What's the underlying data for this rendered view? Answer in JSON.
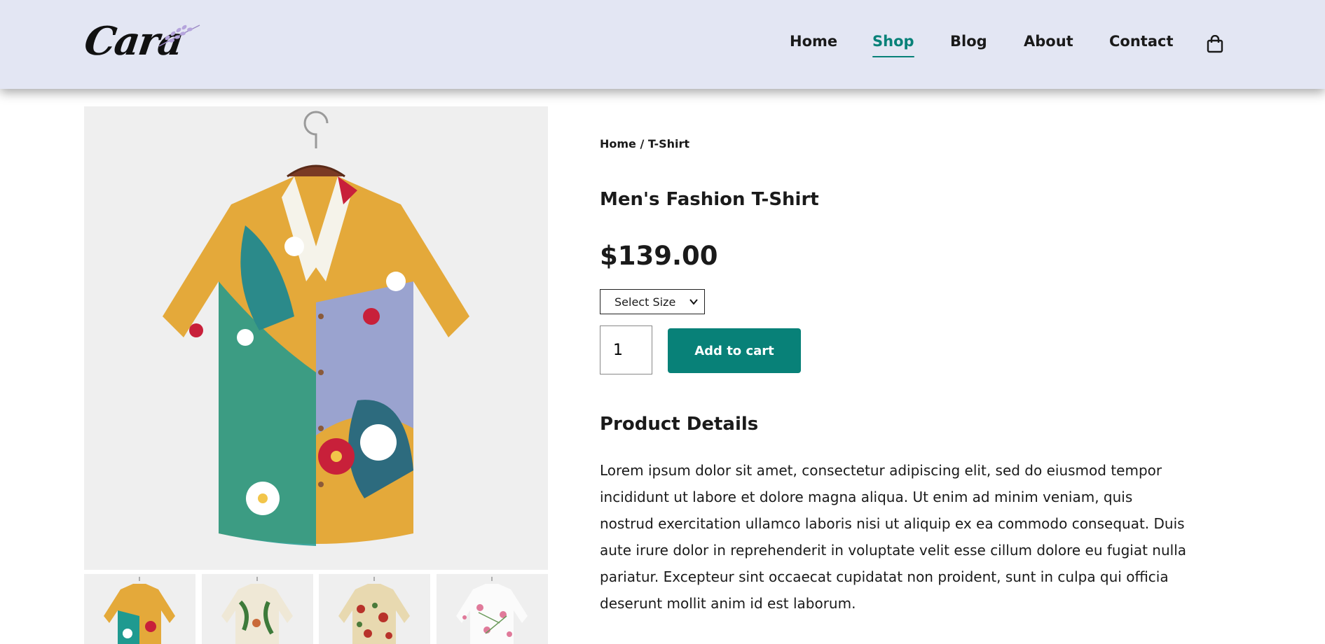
{
  "header": {
    "logo_text": "Cara",
    "nav": [
      {
        "label": "Home",
        "active": false
      },
      {
        "label": "Shop",
        "active": true
      },
      {
        "label": "Blog",
        "active": false
      },
      {
        "label": "About",
        "active": false
      },
      {
        "label": "Contact",
        "active": false
      }
    ],
    "cart_icon": "shopping-bag-icon"
  },
  "product": {
    "breadcrumb": "Home / T-Shirt",
    "title": "Men's Fashion T-Shirt",
    "price": "$139.00",
    "size_select": {
      "selected": "Select Size"
    },
    "quantity": "1",
    "add_to_cart_label": "Add to cart",
    "details_title": "Product Details",
    "description": "Lorem ipsum dolor sit amet, consectetur adipiscing elit, sed do eiusmod tempor incididunt ut labore et dolore magna aliqua. Ut enim ad minim veniam, quis nostrud exercitation ullamco laboris nisi ut aliquip ex ea commodo consequat. Duis aute irure dolor in reprehenderit in voluptate velit esse cillum dolore eu fugiat nulla pariatur. Excepteur sint occaecat cupidatat non proident, sunt in culpa qui officia deserunt mollit anim id est laborum."
  },
  "colors": {
    "header_bg": "#e3e6f3",
    "accent": "#088178",
    "image_bg": "#efefef"
  }
}
